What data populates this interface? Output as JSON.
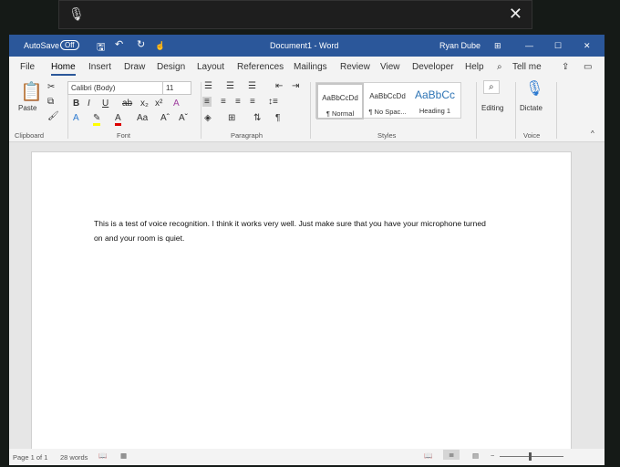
{
  "dictation": {
    "mic_icon": "microphone-icon",
    "close_icon": "close-icon"
  },
  "title": {
    "autosave": "AutoSave",
    "autosave_state": "Off",
    "document": "Document1 - Word",
    "user": "Ryan Dube"
  },
  "tabs": [
    "File",
    "Home",
    "Insert",
    "Draw",
    "Design",
    "Layout",
    "References",
    "Mailings",
    "Review",
    "View",
    "Developer",
    "Help",
    "Tell me"
  ],
  "ribbon": {
    "clipboard": {
      "paste": "Paste",
      "label": "Clipboard"
    },
    "font": {
      "name": "Calibri (Body)",
      "size": "11",
      "label": "Font"
    },
    "paragraph": {
      "label": "Paragraph"
    },
    "styles": {
      "items": [
        {
          "sample": "AaBbCcDd",
          "name": "¶ Normal"
        },
        {
          "sample": "AaBbCcDd",
          "name": "¶ No Spac..."
        },
        {
          "sample": "AaBbCc",
          "name": "Heading 1"
        }
      ],
      "label": "Styles"
    },
    "editing": {
      "label": "Editing"
    },
    "voice": {
      "dictate": "Dictate",
      "label": "Voice"
    }
  },
  "document": {
    "text": "This is a test of voice recognition. I think it works very well. Just make sure that you have your microphone turned on and your room is quiet."
  },
  "status": {
    "page": "Page 1 of 1",
    "words": "28 words"
  }
}
